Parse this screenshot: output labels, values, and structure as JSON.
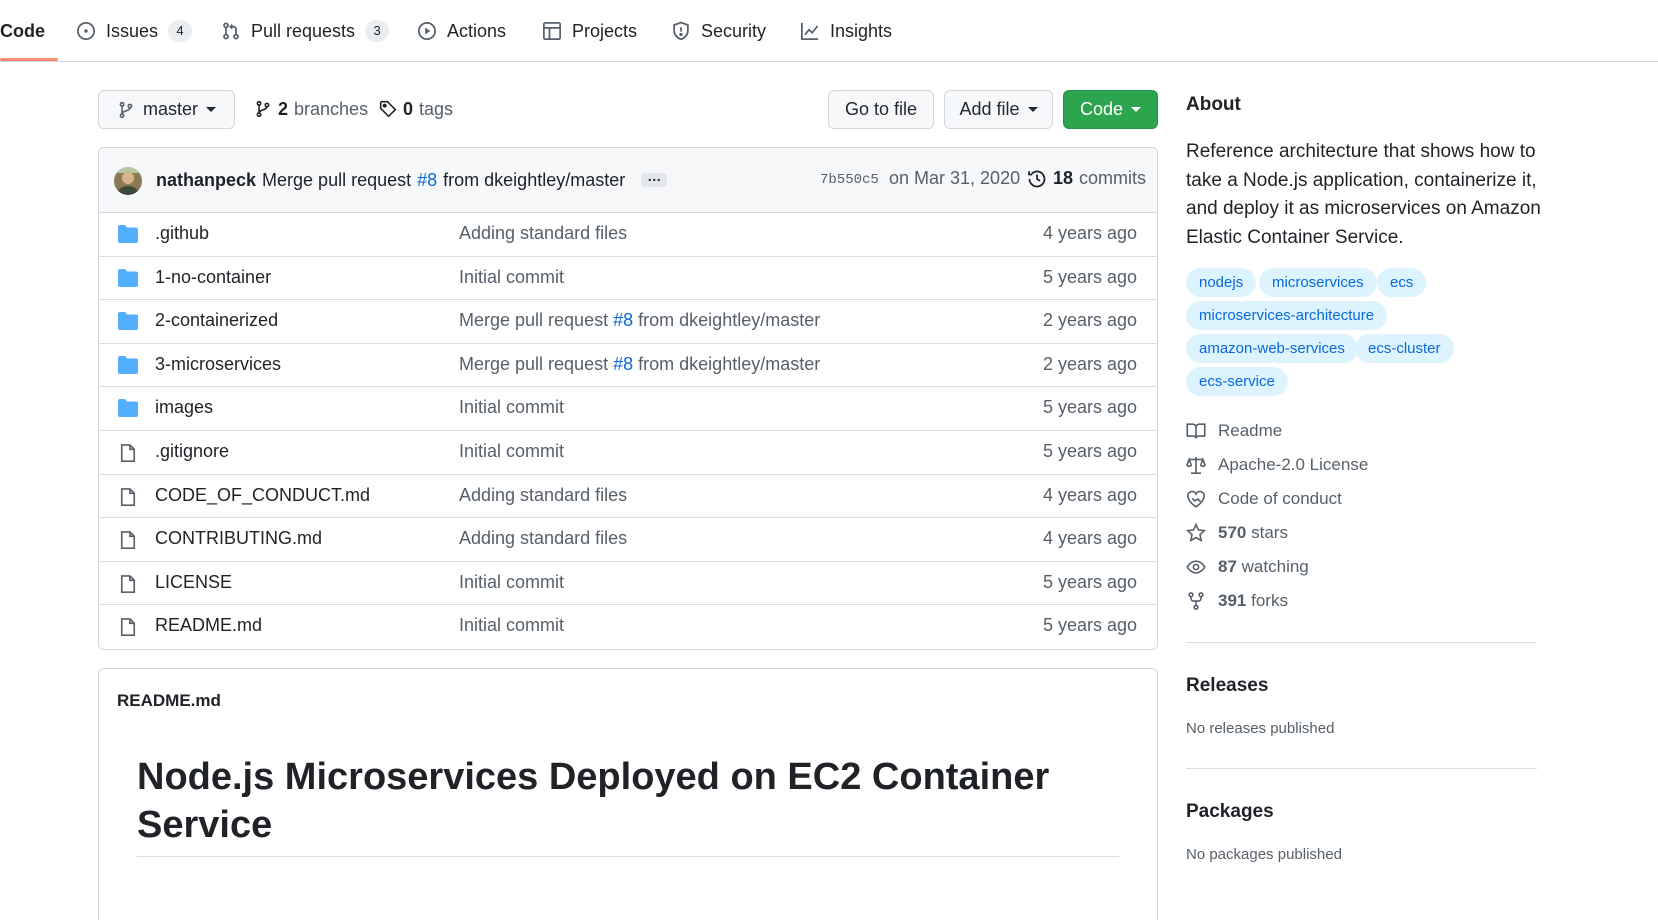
{
  "tabs": [
    {
      "label": "Code",
      "selected": true,
      "icon": "code-icon"
    },
    {
      "label": "Issues",
      "count": "4",
      "icon": "issue-opened-icon"
    },
    {
      "label": "Pull requests",
      "count": "3",
      "icon": "git-pull-request-icon"
    },
    {
      "label": "Actions",
      "icon": "play-icon"
    },
    {
      "label": "Projects",
      "icon": "table-icon"
    },
    {
      "label": "Security",
      "icon": "shield-icon"
    },
    {
      "label": "Insights",
      "icon": "graph-icon"
    }
  ],
  "branch_bar": {
    "branch": "master",
    "branches_count": "2",
    "branches_label": "branches",
    "tags_count": "0",
    "tags_label": "tags",
    "go_to_file": "Go to file",
    "add_file": "Add file",
    "code_button": "Code"
  },
  "latest_commit": {
    "author": "nathanpeck",
    "message_prefix": "Merge pull request",
    "pr": "#8",
    "message_suffix": "from dkeightley/master",
    "ellipsis": "…",
    "sha": "7b550c5",
    "date": "on Mar 31, 2020",
    "commits_count": "18",
    "commits_label": "commits"
  },
  "files": [
    {
      "type": "dir",
      "name": ".github",
      "commit": "Adding standard files",
      "age": "4 years ago"
    },
    {
      "type": "dir",
      "name": "1-no-container",
      "commit": "Initial commit",
      "age": "5 years ago"
    },
    {
      "type": "dir",
      "name": "2-containerized",
      "commit": "Merge pull request",
      "commit_pr": "#8",
      "commit_suffix": "from dkeightley/master",
      "age": "2 years ago"
    },
    {
      "type": "dir",
      "name": "3-microservices",
      "commit": "Merge pull request",
      "commit_pr": "#8",
      "commit_suffix": "from dkeightley/master",
      "age": "2 years ago"
    },
    {
      "type": "dir",
      "name": "images",
      "commit": "Initial commit",
      "age": "5 years ago"
    },
    {
      "type": "file",
      "name": ".gitignore",
      "commit": "Initial commit",
      "age": "5 years ago"
    },
    {
      "type": "file",
      "name": "CODE_OF_CONDUCT.md",
      "commit": "Adding standard files",
      "age": "4 years ago"
    },
    {
      "type": "file",
      "name": "CONTRIBUTING.md",
      "commit": "Adding standard files",
      "age": "4 years ago"
    },
    {
      "type": "file",
      "name": "LICENSE",
      "commit": "Initial commit",
      "age": "5 years ago"
    },
    {
      "type": "file",
      "name": "README.md",
      "commit": "Initial commit",
      "age": "5 years ago"
    }
  ],
  "readme": {
    "filename": "README.md",
    "heading": "Node.js Microservices Deployed on EC2 Container Service"
  },
  "about": {
    "heading": "About",
    "description": "Reference architecture that shows how to take a Node.js application, containerize it, and deploy it as microservices on Amazon Elastic Container Service.",
    "topics": [
      "nodejs",
      "microservices",
      "ecs",
      "microservices-architecture",
      "amazon-web-services",
      "ecs-cluster",
      "ecs-service"
    ],
    "links": [
      {
        "label": "Readme",
        "icon": "book-icon"
      },
      {
        "label": "Apache-2.0 License",
        "icon": "law-icon"
      },
      {
        "label": "Code of conduct",
        "icon": "code-of-conduct-icon"
      },
      {
        "count": "570",
        "label": "stars",
        "icon": "star-icon"
      },
      {
        "count": "87",
        "label": "watching",
        "icon": "eye-icon"
      },
      {
        "count": "391",
        "label": "forks",
        "icon": "repo-forked-icon"
      }
    ]
  },
  "releases": {
    "heading": "Releases",
    "note": "No releases published"
  },
  "packages": {
    "heading": "Packages",
    "note": "No packages published"
  },
  "colors": {
    "accent_link": "#0969da",
    "primary_button": "#2da44e",
    "selected_tab_underline": "#fd8c73",
    "folder_icon": "#54aeff",
    "topic_bg": "#ddf4ff"
  }
}
